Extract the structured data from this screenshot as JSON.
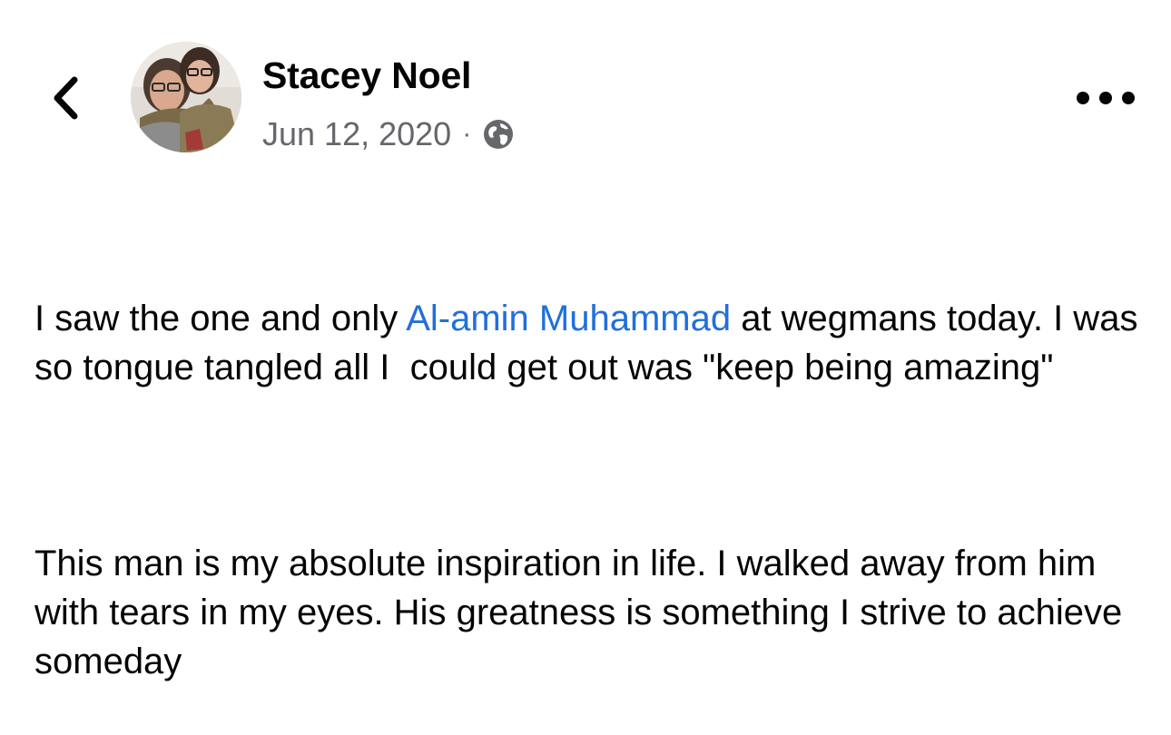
{
  "header": {
    "back_icon": "chevron-left-icon",
    "author_name": "Stacey Noel",
    "date": "Jun 12, 2020",
    "separator": "·",
    "privacy_icon": "globe-icon",
    "more_icon": "more-dots-icon"
  },
  "post": {
    "para1_before": "I saw the one and only ",
    "mention": "Al-amin Muhammad",
    "para1_after": " at wegmans today. I was so tongue tangled all I  could get out was \"keep being amazing\"",
    "para2": "This man is my absolute inspiration in life. I walked away from him with tears in my eyes. His greatness is something I strive to achieve someday"
  },
  "colors": {
    "mention": "#216fdb",
    "meta_text": "#65676b",
    "text": "#050505"
  }
}
